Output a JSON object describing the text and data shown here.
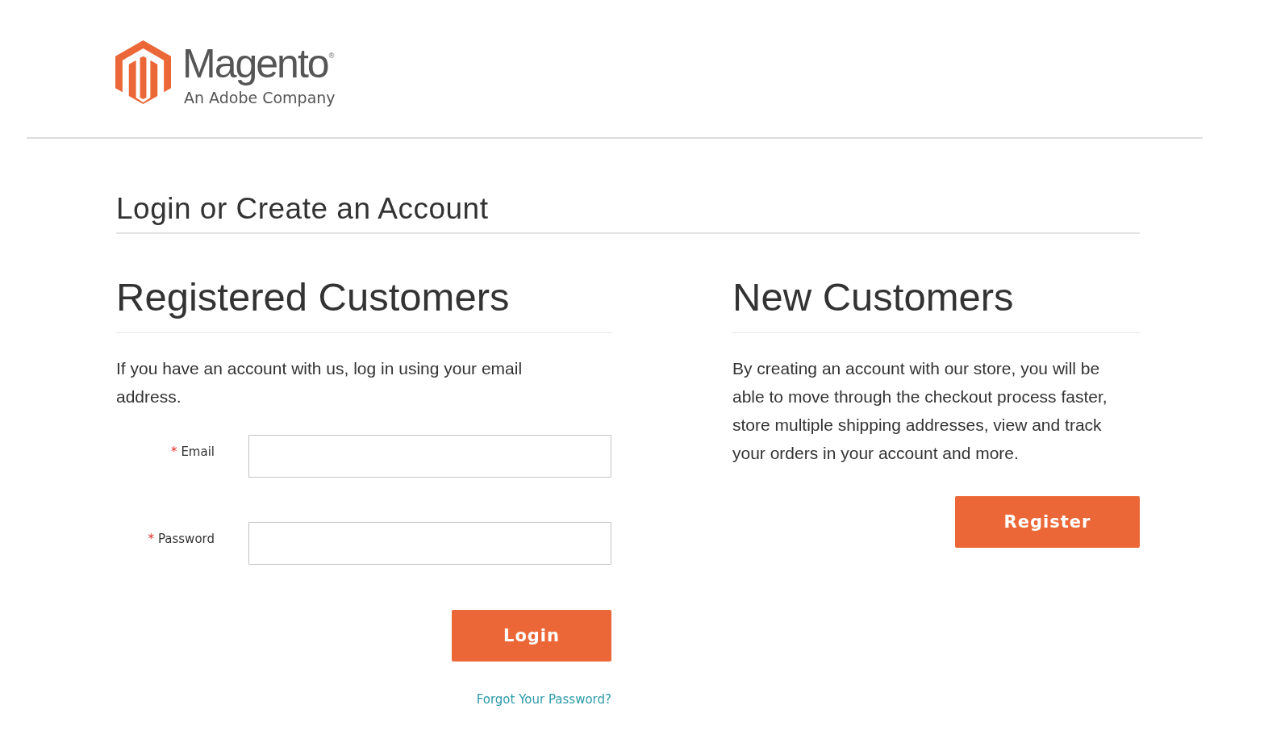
{
  "logo": {
    "name": "Magento",
    "registered": "®",
    "tagline": "An Adobe Company"
  },
  "page_title": "Login or Create an Account",
  "registered": {
    "heading": "Registered Customers",
    "intro": "If you have an account with us, log in using your email address.",
    "fields": [
      {
        "label": "Email",
        "required_mark": "*"
      },
      {
        "label": "Password",
        "required_mark": "*"
      }
    ],
    "button": "Login",
    "forgot_link": "Forgot Your Password?"
  },
  "new_customers": {
    "heading": "New Customers",
    "intro": "By creating an account with our store, you will be able to move through the checkout process faster, store multiple shipping addresses, view and track your orders in your account and more.",
    "button": "Register"
  }
}
